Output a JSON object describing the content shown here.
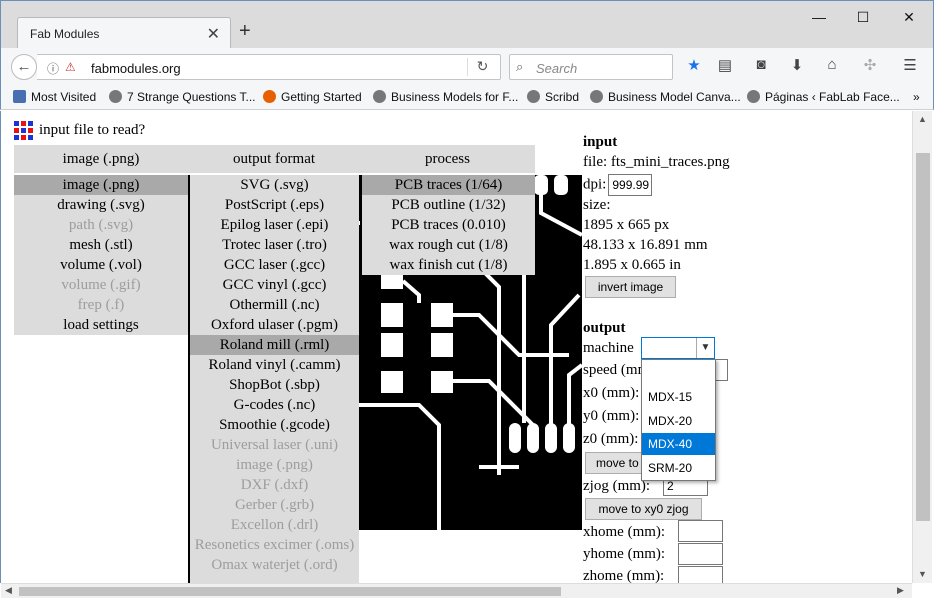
{
  "window": {
    "tab_title": "Fab Modules",
    "tab_close": "✕",
    "new_tab": "+",
    "minimize": "—",
    "maximize": "☐",
    "close": "✕"
  },
  "navbar": {
    "url": "fabmodules.org",
    "search_placeholder": "Search"
  },
  "bookmarks": [
    "Most Visited",
    "7 Strange Questions T...",
    "Getting Started",
    "Business Models for F...",
    "Scribd",
    "Business Model Canva...",
    "Páginas ‹ FabLab Face..."
  ],
  "bookmarks_more": "»",
  "page": {
    "header": "input file to read?",
    "menus": {
      "input": {
        "title": "image (.png)",
        "items": [
          "image (.png)",
          "drawing (.svg)",
          "path (.svg)",
          "mesh (.stl)",
          "volume (.vol)",
          "volume (.gif)",
          "frep (.f)",
          "load settings"
        ],
        "disabled": [
          2,
          5,
          6
        ],
        "selected": 0
      },
      "output": {
        "title": "output format",
        "items": [
          "SVG (.svg)",
          "PostScript (.eps)",
          "Epilog laser (.epi)",
          "Trotec laser (.tro)",
          "GCC laser (.gcc)",
          "GCC vinyl (.gcc)",
          "Othermill (.nc)",
          "Oxford ulaser (.pgm)",
          "Roland mill (.rml)",
          "Roland vinyl (.camm)",
          "ShopBot (.sbp)",
          "G-codes (.nc)",
          "Smoothie (.gcode)",
          "Universal laser (.uni)",
          "image (.png)",
          "DXF (.dxf)",
          "Gerber (.grb)",
          "Excellon (.drl)",
          "Resonetics excimer (.oms)",
          "Omax waterjet (.ord)"
        ],
        "disabled": [
          13,
          14,
          15,
          16,
          17,
          18,
          19
        ],
        "selected": 8
      },
      "process": {
        "title": "process",
        "items": [
          "PCB traces (1/64)",
          "PCB outline (1/32)",
          "PCB traces (0.010)",
          "wax rough cut (1/8)",
          "wax finish cut (1/8)"
        ],
        "disabled": [],
        "selected": 0
      }
    },
    "input_panel": {
      "heading": "input",
      "file_label": "file:",
      "file_value": "fts_mini_traces.png",
      "dpi_label": "dpi:",
      "dpi_value": "999.99",
      "size_label": "size:",
      "size_px": "1895 x 665 px",
      "size_mm": "48.133 x 16.891 mm",
      "size_in": "1.895 x 0.665 in",
      "invert_button": "invert image"
    },
    "output_panel": {
      "heading": "output",
      "machine_label": "machine",
      "machine_value": "",
      "machine_options": [
        "",
        "MDX-15",
        "MDX-20",
        "MDX-40",
        "SRM-20"
      ],
      "machine_highlight": 3,
      "speed_label": "speed (mm/s):",
      "x0_label": "x0 (mm):",
      "y0_label": "y0 (mm):",
      "z0_label": "z0 (mm):",
      "move_xyz0_button": "move to xyz0",
      "zjog_label": "zjog (mm):",
      "zjog_value": "2",
      "move_xy0_zjog_button": "move to xy0 zjog",
      "xhome_label": "xhome (mm):",
      "yhome_label": "yhome (mm):",
      "zhome_label": "zhome (mm):"
    }
  }
}
